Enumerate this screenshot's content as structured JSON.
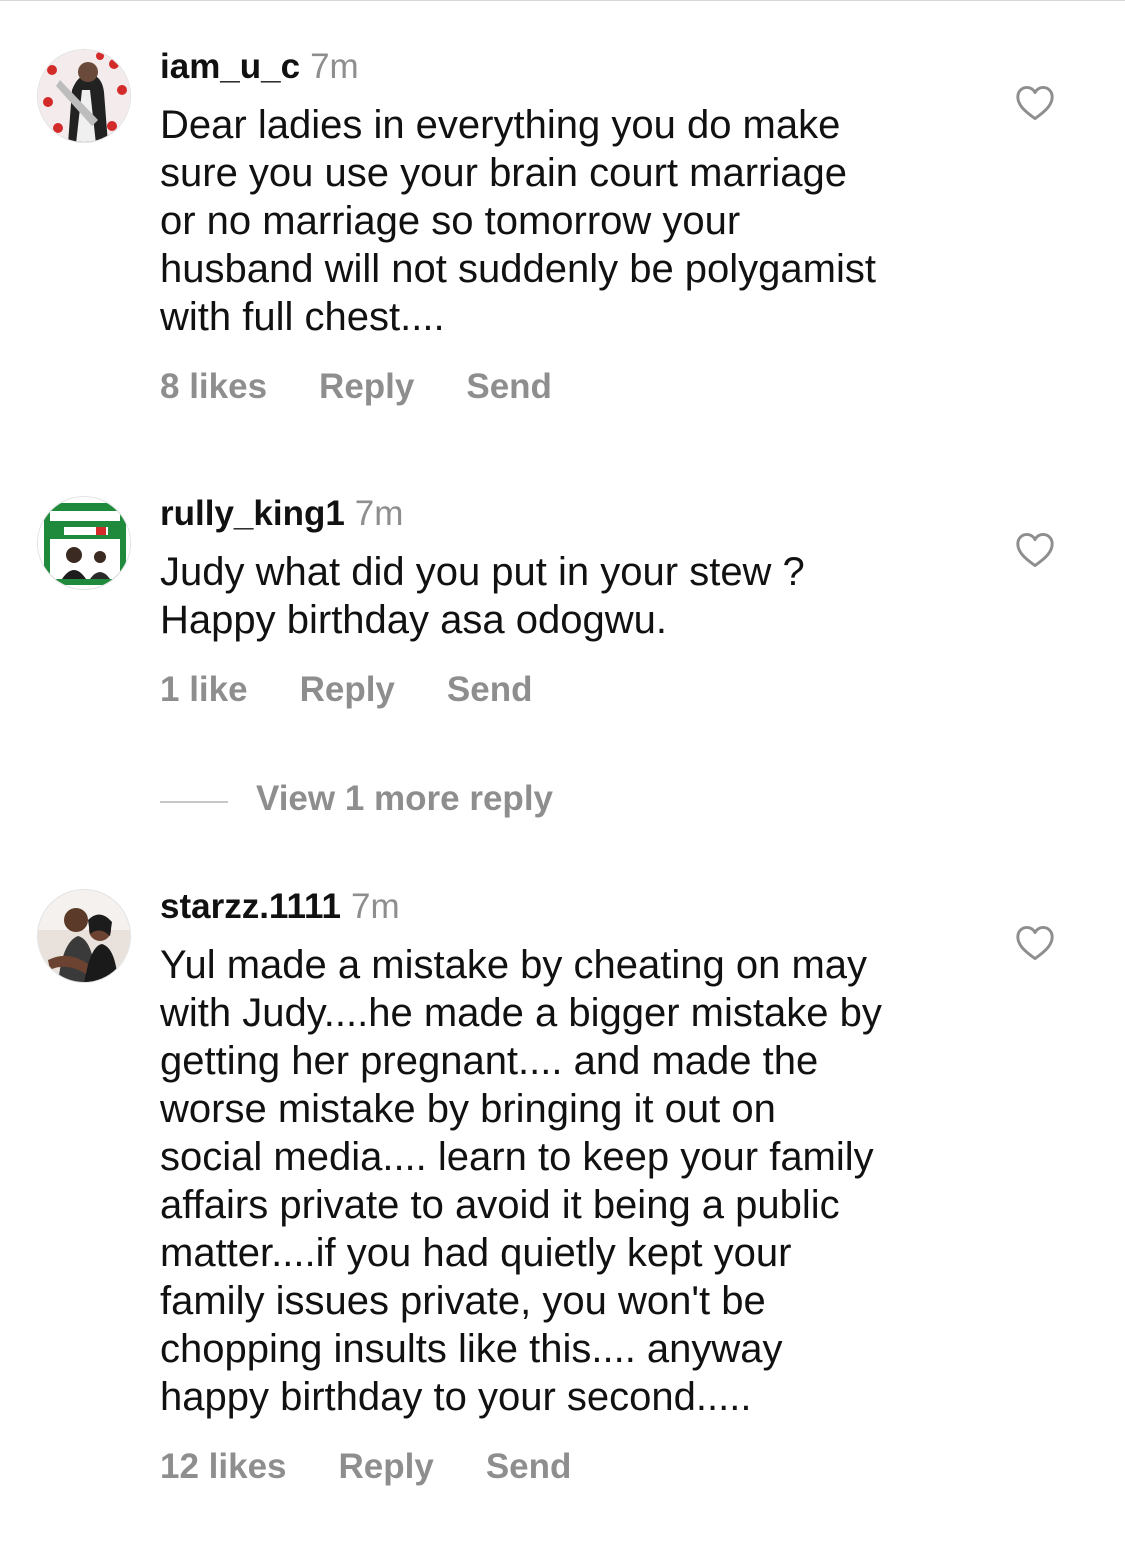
{
  "comments": [
    {
      "username": "iam_u_c",
      "time": "7m",
      "lines": [
        "Dear ladies in everything you do make",
        "sure  you use your brain court marriage",
        "or no marriage so tomorrow your",
        "husband will not suddenly be polygamist",
        "with full chest...."
      ],
      "likes": "8 likes",
      "reply": "Reply",
      "send": "Send"
    },
    {
      "username": "rully_king1",
      "time": "7m",
      "lines": [
        "Judy what did you put in your stew ?",
        "Happy birthday asa odogwu."
      ],
      "likes": "1 like",
      "reply": "Reply",
      "send": "Send",
      "view_more": "View 1 more reply"
    },
    {
      "username": "starzz.1111",
      "time": "7m",
      "lines": [
        "Yul made a mistake by cheating on may",
        "with Judy....he made a bigger mistake by",
        "getting her pregnant.... and made the",
        "worse mistake by bringing it out on",
        "social media.... learn to keep your family",
        "affairs private to avoid it being a public",
        "matter....if you had quietly kept your",
        "family issues private, you won't be",
        "chopping insults like this.... anyway",
        "happy birthday to your second....."
      ],
      "likes": "12 likes",
      "reply": "Reply",
      "send": "Send"
    }
  ],
  "icons": {
    "like": "heart-outline-icon"
  },
  "colors": {
    "text": "#111111",
    "muted": "#8e8e8e",
    "divider": "#c7c7c7"
  }
}
